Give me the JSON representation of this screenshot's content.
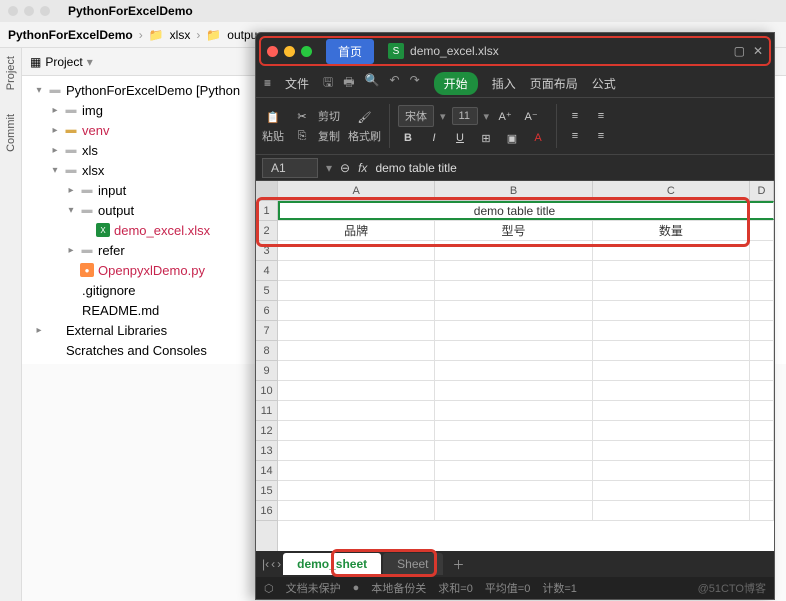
{
  "ide": {
    "title": "PythonForExcelDemo",
    "breadcrumb": [
      "PythonForExcelDemo",
      "xlsx",
      "outpu"
    ],
    "panel_label": "Project",
    "gutter": [
      "Project",
      "Commit"
    ],
    "tree": [
      {
        "depth": 0,
        "chev": "▾",
        "icon": "fold",
        "label": "PythonForExcelDemo [Python"
      },
      {
        "depth": 1,
        "chev": "▸",
        "icon": "fold",
        "label": "img"
      },
      {
        "depth": 1,
        "chev": "▸",
        "icon": "foldy",
        "label": "venv",
        "cls": "sel"
      },
      {
        "depth": 1,
        "chev": "▸",
        "icon": "fold",
        "label": "xls"
      },
      {
        "depth": 1,
        "chev": "▾",
        "icon": "fold",
        "label": "xlsx"
      },
      {
        "depth": 2,
        "chev": "▸",
        "icon": "fold",
        "label": "input"
      },
      {
        "depth": 2,
        "chev": "▾",
        "icon": "fold",
        "label": "output"
      },
      {
        "depth": 3,
        "chev": "",
        "icon": "xl",
        "label": "demo_excel.xlsx",
        "cls": "sel"
      },
      {
        "depth": 2,
        "chev": "▸",
        "icon": "fold",
        "label": "refer"
      },
      {
        "depth": 2,
        "chev": "",
        "icon": "py",
        "label": "OpenpyxlDemo.py",
        "cls": "py"
      },
      {
        "depth": 1,
        "chev": "",
        "icon": "",
        "label": ".gitignore"
      },
      {
        "depth": 1,
        "chev": "",
        "icon": "",
        "label": "README.md"
      },
      {
        "depth": 0,
        "chev": "▸",
        "icon": "",
        "label": "External Libraries"
      },
      {
        "depth": 0,
        "chev": "",
        "icon": "",
        "label": "Scratches and Consoles"
      }
    ]
  },
  "excel": {
    "home_tab": "首页",
    "filename": "demo_excel.xlsx",
    "menu": {
      "file": "文件",
      "start": "开始",
      "insert": "插入",
      "layout": "页面布局",
      "formula": "公式"
    },
    "tools": {
      "paste": "粘贴",
      "cut": "剪切",
      "copy": "复制",
      "format": "格式刷",
      "font": "宋体",
      "size": "11"
    },
    "cellref": "A1",
    "formula_value": "demo table title",
    "cols": [
      "A",
      "B",
      "C",
      "D"
    ],
    "rows": [
      "1",
      "2",
      "3",
      "4",
      "5",
      "6",
      "7",
      "8",
      "9",
      "10",
      "11",
      "12",
      "13",
      "14",
      "15",
      "16"
    ],
    "row1_merged": "demo table title",
    "row2": [
      "品牌",
      "型号",
      "数量"
    ],
    "sheets": {
      "active": "demo_sheet",
      "other": "Sheet"
    },
    "status": {
      "protect": "文档未保护",
      "backup": "本地备份关",
      "sum": "求和=0",
      "avg": "平均值=0",
      "count": "计数=1"
    },
    "watermark": "@51CTO博客"
  }
}
